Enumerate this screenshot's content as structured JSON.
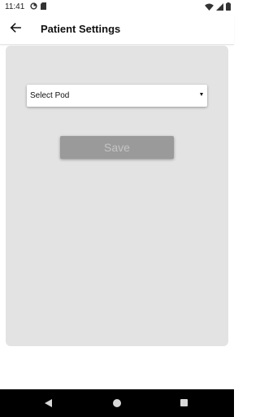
{
  "status_bar": {
    "time": "11:41",
    "icons": [
      "data-saver-icon",
      "sd-card-icon",
      "wifi-icon",
      "cellular-icon",
      "battery-icon"
    ]
  },
  "app_bar": {
    "back_icon": "arrow-left-icon",
    "title": "Patient Settings"
  },
  "form": {
    "pod_select": {
      "selected_value": "Select Pod"
    },
    "save_label": "Save"
  },
  "nav_bar": {
    "icons": [
      "triangle-back-icon",
      "circle-home-icon",
      "square-recents-icon"
    ]
  },
  "colors": {
    "card_background": "#e3e3e3",
    "save_button_background": "#9a9a9a",
    "save_button_text": "#c4c4c4",
    "nav_background": "#000000"
  }
}
